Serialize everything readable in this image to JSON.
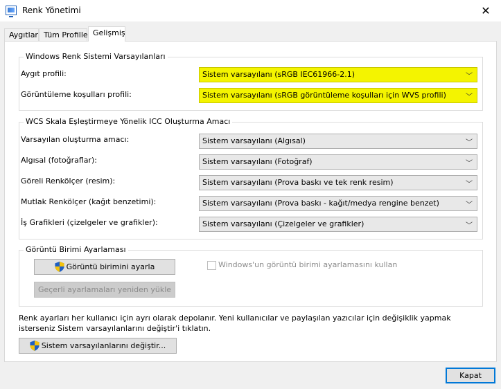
{
  "window": {
    "title": "Renk Yönetimi"
  },
  "tabs": [
    {
      "label": "Aygıtlar"
    },
    {
      "label": "Tüm Profiller"
    },
    {
      "label": "Gelişmiş"
    }
  ],
  "wcs_defaults": {
    "title": "Windows Renk Sistemi Varsayılanları",
    "device_profile": {
      "label": "Aygıt profili:",
      "value": "Sistem varsayılanı (sRGB IEC61966-2.1)"
    },
    "viewing_conditions": {
      "label": "Görüntüleme koşulları profili:",
      "value": "Sistem varsayılanı (sRGB görüntüleme koşulları için WVS profili)"
    }
  },
  "icc_mapping": {
    "title": "WCS Skala Eşleştirmeye Yönelik ICC Oluşturma Amacı",
    "rows": [
      {
        "label": "Varsayılan oluşturma amacı:",
        "value": "Sistem varsayılanı (Algısal)"
      },
      {
        "label": "Algısal (fotoğraflar):",
        "value": "Sistem varsayılanı (Fotoğraf)"
      },
      {
        "label": "Göreli Renkölçer (resim):",
        "value": "Sistem varsayılanı (Prova baskı ve tek renk resim)"
      },
      {
        "label": "Mutlak Renkölçer (kağıt benzetimi):",
        "value": "Sistem varsayılanı (Prova baskı - kağıt/medya rengine benzet)"
      },
      {
        "label": "İş Grafikleri (çizelgeler ve grafikler):",
        "value": "Sistem varsayılanı (Çizelgeler ve grafikler)"
      }
    ]
  },
  "display_calibration": {
    "title": "Görüntü Birimi Ayarlaması",
    "calibrate_label": "Görüntü birimini ayarla",
    "reload_label": "Geçerli ayarlamaları yeniden yükle",
    "use_windows_label": "Windows'un görüntü birimi ayarlamasını kullan"
  },
  "info_text": "Renk ayarları her kullanıcı için ayrı olarak depolanır. Yeni kullanıcılar ve paylaşılan yazıcılar için değişiklik yapmak isterseniz Sistem varsayılanlarını değiştir'i tıklatın.",
  "change_defaults_label": "Sistem varsayılanlarını değiştir...",
  "close_label": "Kapat",
  "colors": {
    "highlight": "#f4f400",
    "accent": "#0078d7"
  }
}
